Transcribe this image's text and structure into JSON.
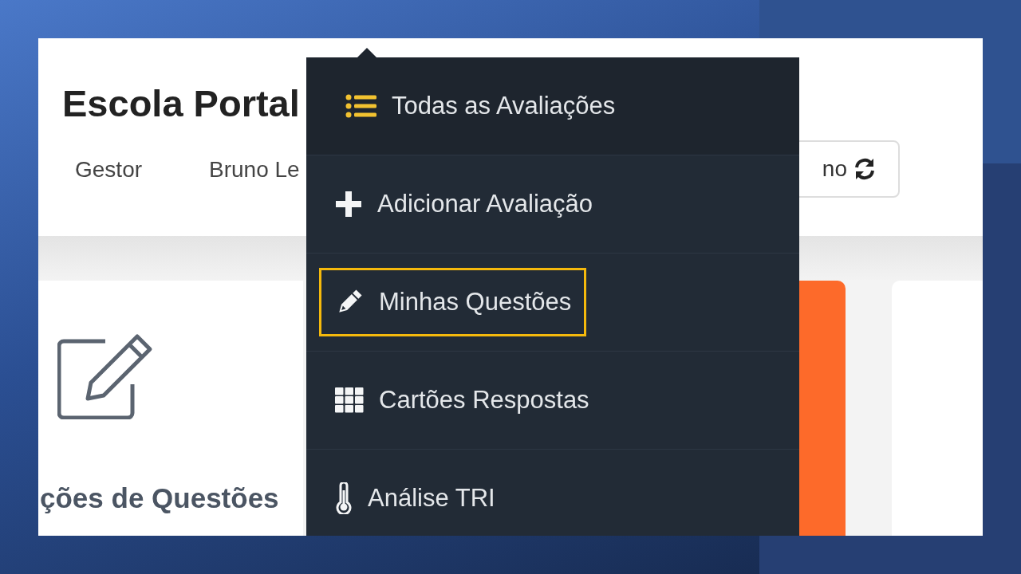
{
  "header": {
    "title": "Escola Portal",
    "nav": [
      "Gestor",
      "Bruno Le"
    ],
    "button": {
      "label": "no"
    }
  },
  "card": {
    "caption": "ções de Questões"
  },
  "menu": {
    "items": [
      {
        "kind": "list",
        "label": "Todas as Avaliações",
        "selected": true,
        "highlighted": false
      },
      {
        "kind": "plus",
        "label": "Adicionar Avaliação",
        "selected": false,
        "highlighted": false
      },
      {
        "kind": "pencil",
        "label": "Minhas Questões",
        "selected": false,
        "highlighted": true
      },
      {
        "kind": "grid",
        "label": "Cartões Respostas",
        "selected": false,
        "highlighted": false
      },
      {
        "kind": "thermometer",
        "label": "Análise TRI",
        "selected": false,
        "highlighted": false
      }
    ]
  }
}
